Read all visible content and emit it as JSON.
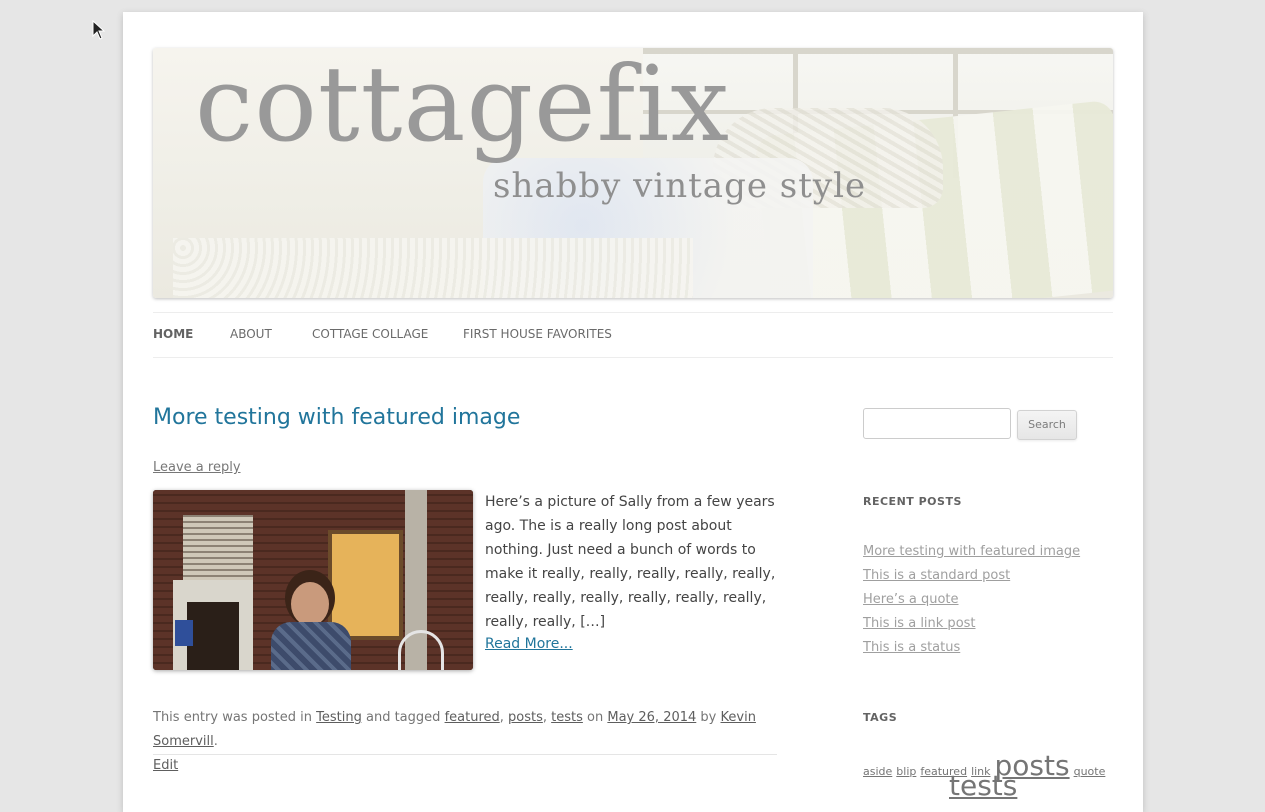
{
  "site": {
    "logo": "cottagefix",
    "tagline": "shabby vintage style"
  },
  "nav": {
    "items": [
      "HOME",
      "ABOUT",
      "COTTAGE COLLAGE",
      "FIRST HOUSE FAVORITES"
    ]
  },
  "post": {
    "title": "More testing with featured image",
    "reply": "Leave a reply",
    "excerpt": "Here’s a picture of Sally from a few years ago. The is a really long post about nothing. Just need a bunch of words to make it really, really, really, really, really, really, really, really, really, really, really, really, really, […]",
    "read_more": "Read More...",
    "meta": {
      "posted_in": "This entry was posted in",
      "category": "Testing",
      "tagged": "and tagged",
      "tags": [
        "featured",
        "posts",
        "tests"
      ],
      "on": "on",
      "date": "May 26, 2014",
      "by": "by",
      "author": "Kevin Somervill",
      "edit": "Edit"
    }
  },
  "sidebar": {
    "search_button": "Search",
    "recent_title": "RECENT POSTS",
    "recent_posts": [
      "More testing with featured image",
      "This is a standard post",
      "Here’s a quote",
      "This is a link post",
      "This is a status"
    ],
    "tags_title": "TAGS",
    "tags": [
      "aside",
      "blip",
      "featured",
      "link",
      "posts",
      "quote",
      "tests"
    ]
  }
}
